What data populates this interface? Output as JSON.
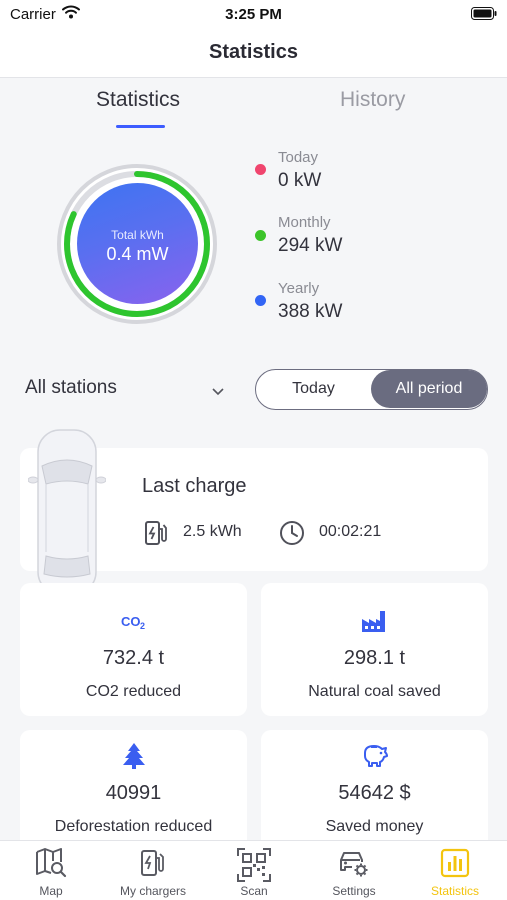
{
  "status_bar": {
    "carrier": "Carrier",
    "time": "3:25 PM"
  },
  "header": {
    "title": "Statistics"
  },
  "tabs": [
    {
      "label": "Statistics",
      "active": true
    },
    {
      "label": "History",
      "active": false
    }
  ],
  "gauge": {
    "label": "Total kWh",
    "value": "0.4 mW",
    "progress": 0.82,
    "ring_color": "#2ec52e"
  },
  "legend": [
    {
      "label": "Today",
      "value": "0 kW",
      "color": "#f0456e"
    },
    {
      "label": "Monthly",
      "value": "294 kW",
      "color": "#3cc42a"
    },
    {
      "label": "Yearly",
      "value": "388 kW",
      "color": "#3265f5"
    }
  ],
  "filters": {
    "station": "All stations",
    "period_options": [
      "Today",
      "All period"
    ],
    "period_selected": "All period"
  },
  "last_charge": {
    "title": "Last charge",
    "energy": "2.5 kWh",
    "duration": "00:02:21"
  },
  "stats": [
    {
      "icon": "co2-icon",
      "value": "732.4 t",
      "label": "CO2 reduced"
    },
    {
      "icon": "factory-icon",
      "value": "298.1 t",
      "label": "Natural coal saved"
    },
    {
      "icon": "tree-icon",
      "value": "40991",
      "label": "Deforestation reduced"
    },
    {
      "icon": "piggy-bank-icon",
      "value": "54642 $",
      "label": "Saved money"
    }
  ],
  "tabbar": [
    {
      "label": "Map",
      "icon": "map-search-icon",
      "active": false
    },
    {
      "label": "My chargers",
      "icon": "charger-icon",
      "active": false
    },
    {
      "label": "Scan",
      "icon": "qr-code-icon",
      "active": false
    },
    {
      "label": "Settings",
      "icon": "car-settings-icon",
      "active": false
    },
    {
      "label": "Statistics",
      "icon": "bar-chart-icon",
      "active": true
    }
  ],
  "colors": {
    "accent": "#3d5cff",
    "active_tab": "#f3c40f",
    "icon_blue": "#3a5ef0"
  }
}
